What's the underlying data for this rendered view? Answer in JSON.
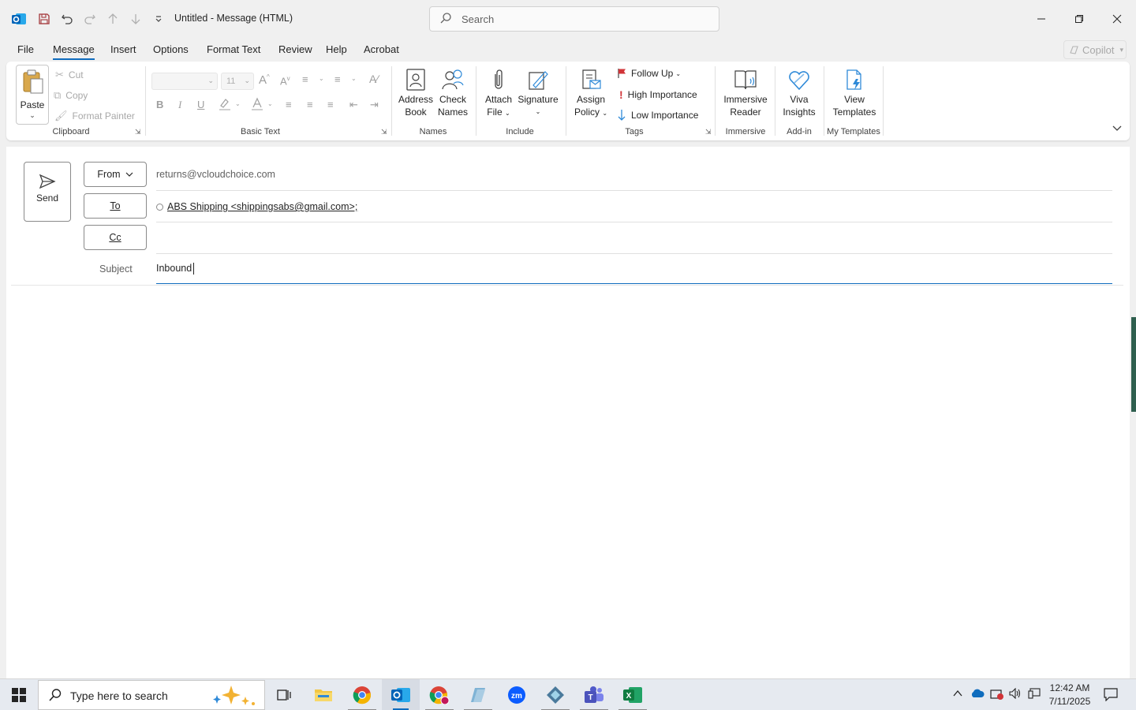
{
  "window": {
    "title": "Untitled  -  Message (HTML)",
    "search_placeholder": "Search"
  },
  "menu": {
    "tabs": [
      "File",
      "Message",
      "Insert",
      "Options",
      "Format Text",
      "Review",
      "Help",
      "Acrobat"
    ],
    "active_tab": "Message",
    "copilot": "Copilot"
  },
  "ribbon": {
    "clipboard": {
      "paste": "Paste",
      "cut": "Cut",
      "copy": "Copy",
      "format_painter": "Format Painter",
      "label": "Clipboard"
    },
    "basic_text": {
      "font_size": "11",
      "label": "Basic Text"
    },
    "names": {
      "address_book_1": "Address",
      "address_book_2": "Book",
      "check_names_1": "Check",
      "check_names_2": "Names",
      "label": "Names"
    },
    "include": {
      "attach_file_1": "Attach",
      "attach_file_2": "File",
      "signature": "Signature",
      "label": "Include"
    },
    "tags": {
      "assign_policy_1": "Assign",
      "assign_policy_2": "Policy",
      "follow_up": "Follow Up",
      "high_importance": "High Importance",
      "low_importance": "Low Importance",
      "label": "Tags"
    },
    "immersive": {
      "reader_1": "Immersive",
      "reader_2": "Reader",
      "label": "Immersive"
    },
    "addin": {
      "viva_1": "Viva",
      "viva_2": "Insights",
      "label": "Add-in"
    },
    "templates": {
      "view_1": "View",
      "view_2": "Templates",
      "label": "My Templates"
    }
  },
  "compose": {
    "send": "Send",
    "from_label": "From",
    "from_value": "returns@vcloudchoice.com",
    "to_label": "To",
    "to_recipient": "ABS Shipping <shippingsabs@gmail.com>;",
    "cc_label": "Cc",
    "cc_value": "",
    "subject_label": "Subject",
    "subject_value": "Inbound"
  },
  "taskbar": {
    "search_placeholder": "Type here to search",
    "time": "12:42 AM",
    "date": "7/11/2025"
  }
}
